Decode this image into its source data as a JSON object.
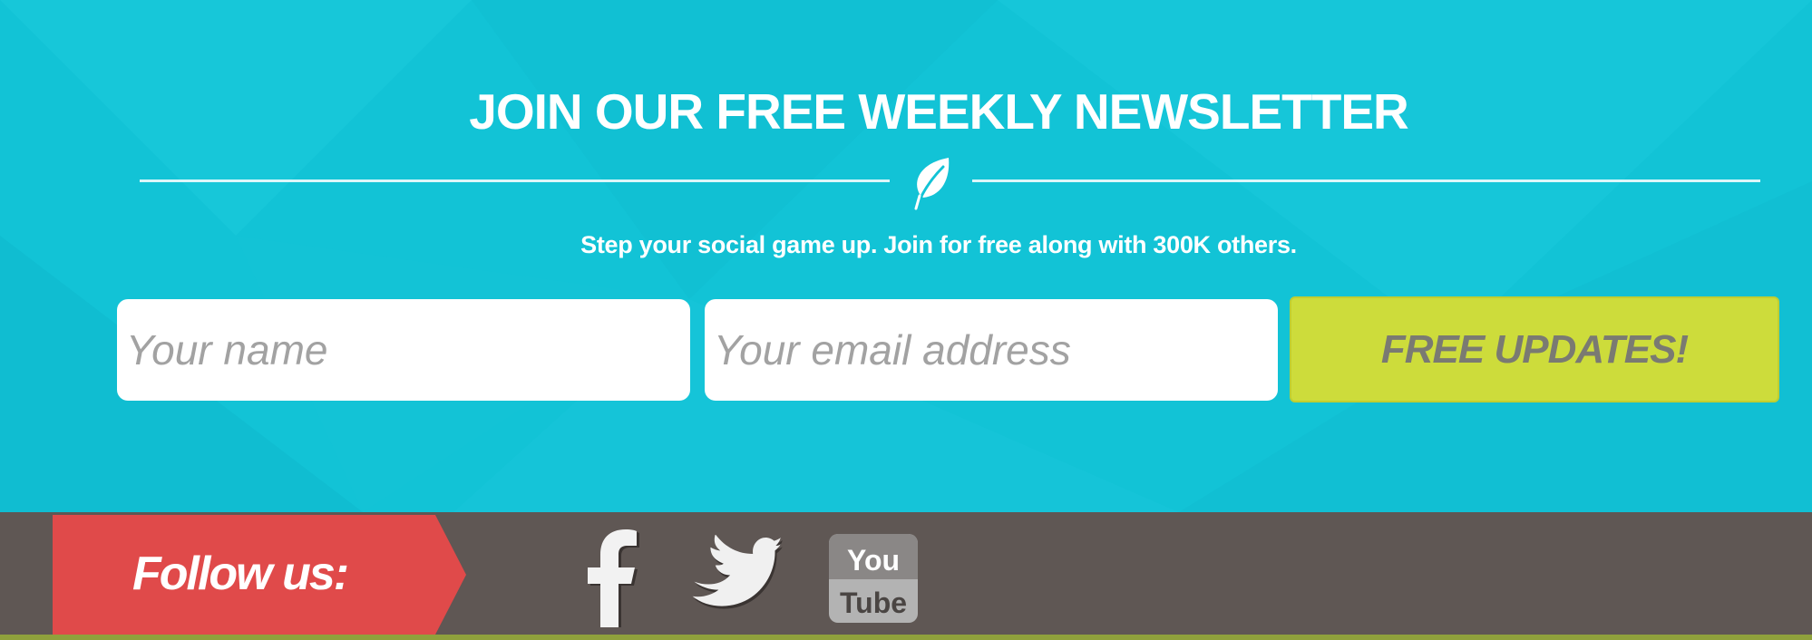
{
  "newsletter": {
    "title": "JOIN OUR FREE WEEKLY NEWSLETTER",
    "divider_icon": "leaf-icon",
    "subtitle": "Step your social game up. Join for free along with 300K others.",
    "name_placeholder": "Your name",
    "email_placeholder": "Your email address",
    "submit_label": "FREE UPDATES!",
    "background_color": "#12c3d6",
    "button_color": "#cddc3b"
  },
  "footer": {
    "follow_label": "Follow us:",
    "ribbon_color": "#e04a4a",
    "background_color": "#5f5754",
    "social_links": [
      {
        "icon": "facebook-icon"
      },
      {
        "icon": "twitter-icon"
      },
      {
        "icon": "youtube-icon",
        "logo_text_top": "You",
        "logo_text_bottom": "Tube"
      }
    ]
  }
}
